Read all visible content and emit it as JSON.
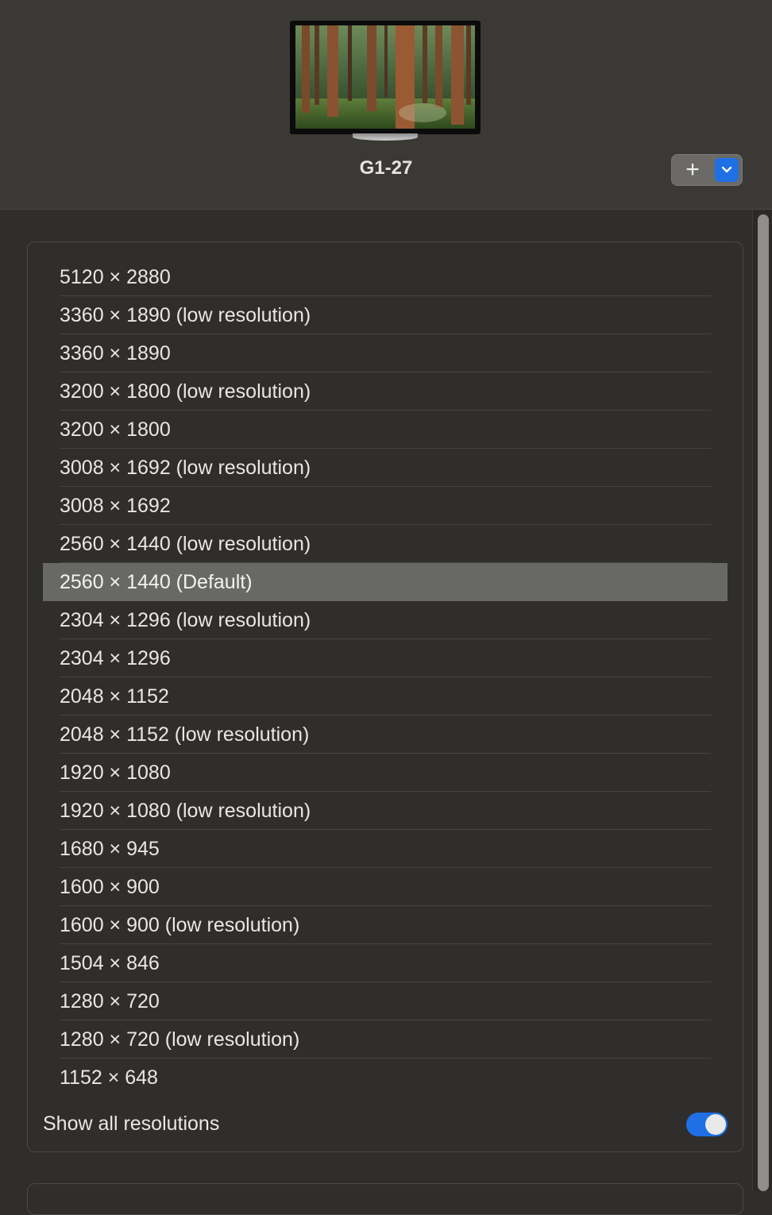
{
  "display": {
    "name": "G1-27",
    "thumbnail_icon": "display-wallpaper-forest"
  },
  "toolbar": {
    "add_icon": "plus-icon",
    "menu_icon": "chevron-down-icon"
  },
  "resolutions": [
    {
      "label": "5120 × 2880",
      "selected": false
    },
    {
      "label": "3360 × 1890 (low resolution)",
      "selected": false
    },
    {
      "label": "3360 × 1890",
      "selected": false
    },
    {
      "label": "3200 × 1800 (low resolution)",
      "selected": false
    },
    {
      "label": "3200 × 1800",
      "selected": false
    },
    {
      "label": "3008 × 1692 (low resolution)",
      "selected": false
    },
    {
      "label": "3008 × 1692",
      "selected": false
    },
    {
      "label": "2560 × 1440 (low resolution)",
      "selected": false
    },
    {
      "label": "2560 × 1440 (Default)",
      "selected": true
    },
    {
      "label": "2304 × 1296 (low resolution)",
      "selected": false
    },
    {
      "label": "2304 × 1296",
      "selected": false
    },
    {
      "label": "2048 × 1152",
      "selected": false
    },
    {
      "label": "2048 × 1152 (low resolution)",
      "selected": false
    },
    {
      "label": "1920 × 1080",
      "selected": false
    },
    {
      "label": "1920 × 1080 (low resolution)",
      "selected": false
    },
    {
      "label": "1680 × 945",
      "selected": false
    },
    {
      "label": "1600 × 900",
      "selected": false
    },
    {
      "label": "1600 × 900 (low resolution)",
      "selected": false
    },
    {
      "label": "1504 × 846",
      "selected": false
    },
    {
      "label": "1280 × 720",
      "selected": false
    },
    {
      "label": "1280 × 720 (low resolution)",
      "selected": false
    },
    {
      "label": "1152 × 648",
      "selected": false
    }
  ],
  "show_all": {
    "label": "Show all resolutions",
    "enabled": true
  },
  "colors": {
    "accent": "#1f6fe5",
    "selected_row": "#686864",
    "background": "#2f2e2c"
  }
}
